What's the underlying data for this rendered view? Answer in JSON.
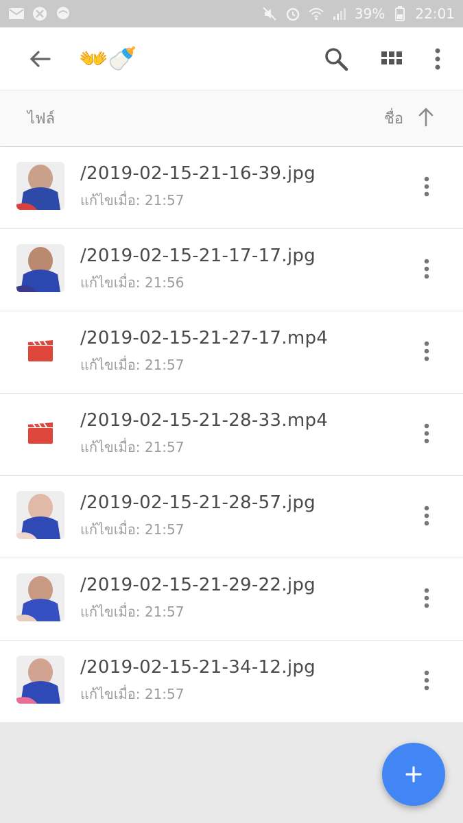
{
  "status_bar": {
    "left_icons": [
      "mail-icon",
      "blocked-icon",
      "chat-bubble-icon"
    ],
    "right_icons": [
      "mute-icon",
      "alarm-icon",
      "wifi-icon",
      "signal-icon",
      "battery-icon"
    ],
    "battery": "39%",
    "time": "22:01"
  },
  "app_bar": {
    "title": "👐🍼",
    "actions": [
      "search-icon",
      "grid-view-icon",
      "more-vert-icon"
    ]
  },
  "sort_bar": {
    "label": "ไฟล์",
    "sort_by": "ชื่อ",
    "sort_direction": "ascending"
  },
  "files": [
    {
      "name": "/2019-02-15-21-16-39.jpg",
      "modified": "แก้ไขเมื่อ: 21:57",
      "type": "image"
    },
    {
      "name": "/2019-02-15-21-17-17.jpg",
      "modified": "แก้ไขเมื่อ: 21:56",
      "type": "image"
    },
    {
      "name": "/2019-02-15-21-27-17.mp4",
      "modified": "แก้ไขเมื่อ: 21:57",
      "type": "video"
    },
    {
      "name": "/2019-02-15-21-28-33.mp4",
      "modified": "แก้ไขเมื่อ: 21:57",
      "type": "video"
    },
    {
      "name": "/2019-02-15-21-28-57.jpg",
      "modified": "แก้ไขเมื่อ: 21:57",
      "type": "image"
    },
    {
      "name": "/2019-02-15-21-29-22.jpg",
      "modified": "แก้ไขเมื่อ: 21:57",
      "type": "image"
    },
    {
      "name": "/2019-02-15-21-34-12.jpg",
      "modified": "แก้ไขเมื่อ: 21:57",
      "type": "image"
    }
  ],
  "fab": {
    "icon": "plus-icon"
  },
  "colors": {
    "fab": "#4286f5",
    "video_icon": "#e0473c",
    "status_bar": "#c9c9c9",
    "background": "#e9e9e9"
  }
}
